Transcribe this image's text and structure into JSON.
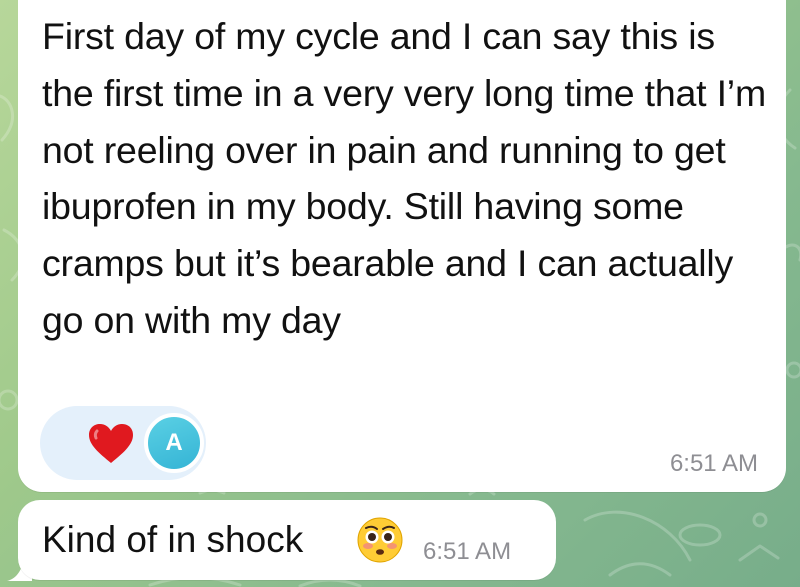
{
  "chat": {
    "messages": [
      {
        "text": "First day of my cycle and I can say this is the first time in a very very long time that I’m not reeling over in pain and running to get ibuprofen in my body. Still having some cramps but it’s bearable and I can actually go on with my day",
        "time": "6:51 AM",
        "reactions": {
          "icon": "heart-icon",
          "avatar_initial": "A"
        }
      },
      {
        "text": "Kind of in shock",
        "emoji": "flushed-face-emoji",
        "time": "6:51 AM"
      }
    ]
  },
  "colors": {
    "bubble": "#ffffff",
    "reaction_pill": "#e4f0fb",
    "heart": "#e0191f",
    "avatar": "#45c1dc",
    "timestamp": "#8e8e93",
    "wallpaper": "#9fc98b"
  }
}
